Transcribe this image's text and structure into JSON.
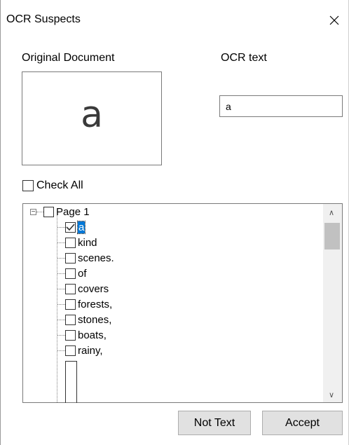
{
  "window": {
    "title": "OCR Suspects"
  },
  "labels": {
    "original_document": "Original Document",
    "ocr_text": "OCR text"
  },
  "preview": {
    "glyph": "a"
  },
  "ocr_input": {
    "value": "a"
  },
  "check_all": {
    "label": "Check All",
    "checked": false
  },
  "tree": {
    "root": {
      "label": "Page 1",
      "expanded": true,
      "checked": false
    },
    "items": [
      {
        "label": "a",
        "checked": true,
        "selected": true
      },
      {
        "label": "kind",
        "checked": false
      },
      {
        "label": "scenes.",
        "checked": false
      },
      {
        "label": "of",
        "checked": false
      },
      {
        "label": "covers",
        "checked": false
      },
      {
        "label": "forests,",
        "checked": false
      },
      {
        "label": "stones,",
        "checked": false
      },
      {
        "label": "boats,",
        "checked": false
      },
      {
        "label": "rainy,",
        "checked": false
      }
    ]
  },
  "buttons": {
    "not_text": "Not Text",
    "accept": "Accept"
  }
}
